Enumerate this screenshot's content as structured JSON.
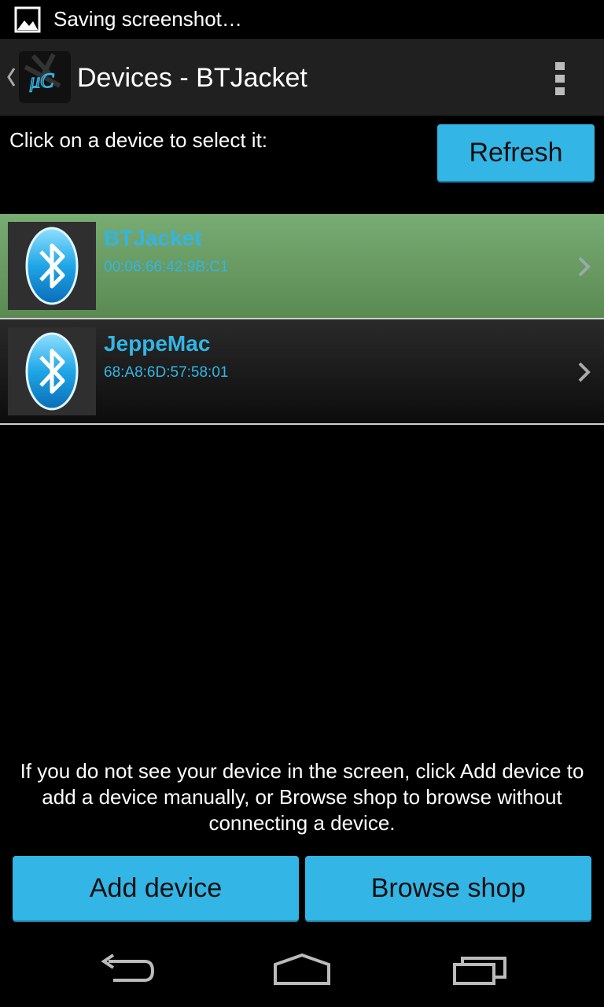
{
  "status_bar": {
    "icon": "image-icon",
    "text": "Saving screenshot…"
  },
  "action_bar": {
    "title": "Devices - BTJacket",
    "logo_text": "μC",
    "logo_icon": "app-logo",
    "overflow_icon": "overflow-menu-icon"
  },
  "main": {
    "prompt": "Click on a device to select it:",
    "refresh_label": "Refresh",
    "devices": [
      {
        "name": "BTJacket",
        "address": "00:06:66:42:9B:C1",
        "selected": true,
        "icon": "bluetooth-icon"
      },
      {
        "name": "JeppeMac",
        "address": "68:A8:6D:57:58:01",
        "selected": false,
        "icon": "bluetooth-icon"
      }
    ],
    "help_text": "If you do not see your device in the screen, click Add device to add a device manually, or Browse shop to browse without connecting a device.",
    "add_device_label": "Add device",
    "browse_shop_label": "Browse shop"
  },
  "nav_bar": {
    "back_icon": "back-icon",
    "home_icon": "home-icon",
    "recents_icon": "recents-icon"
  },
  "colors": {
    "accent": "#33b5e5",
    "selected_row": "#6a9d64",
    "action_bar": "#202020"
  }
}
